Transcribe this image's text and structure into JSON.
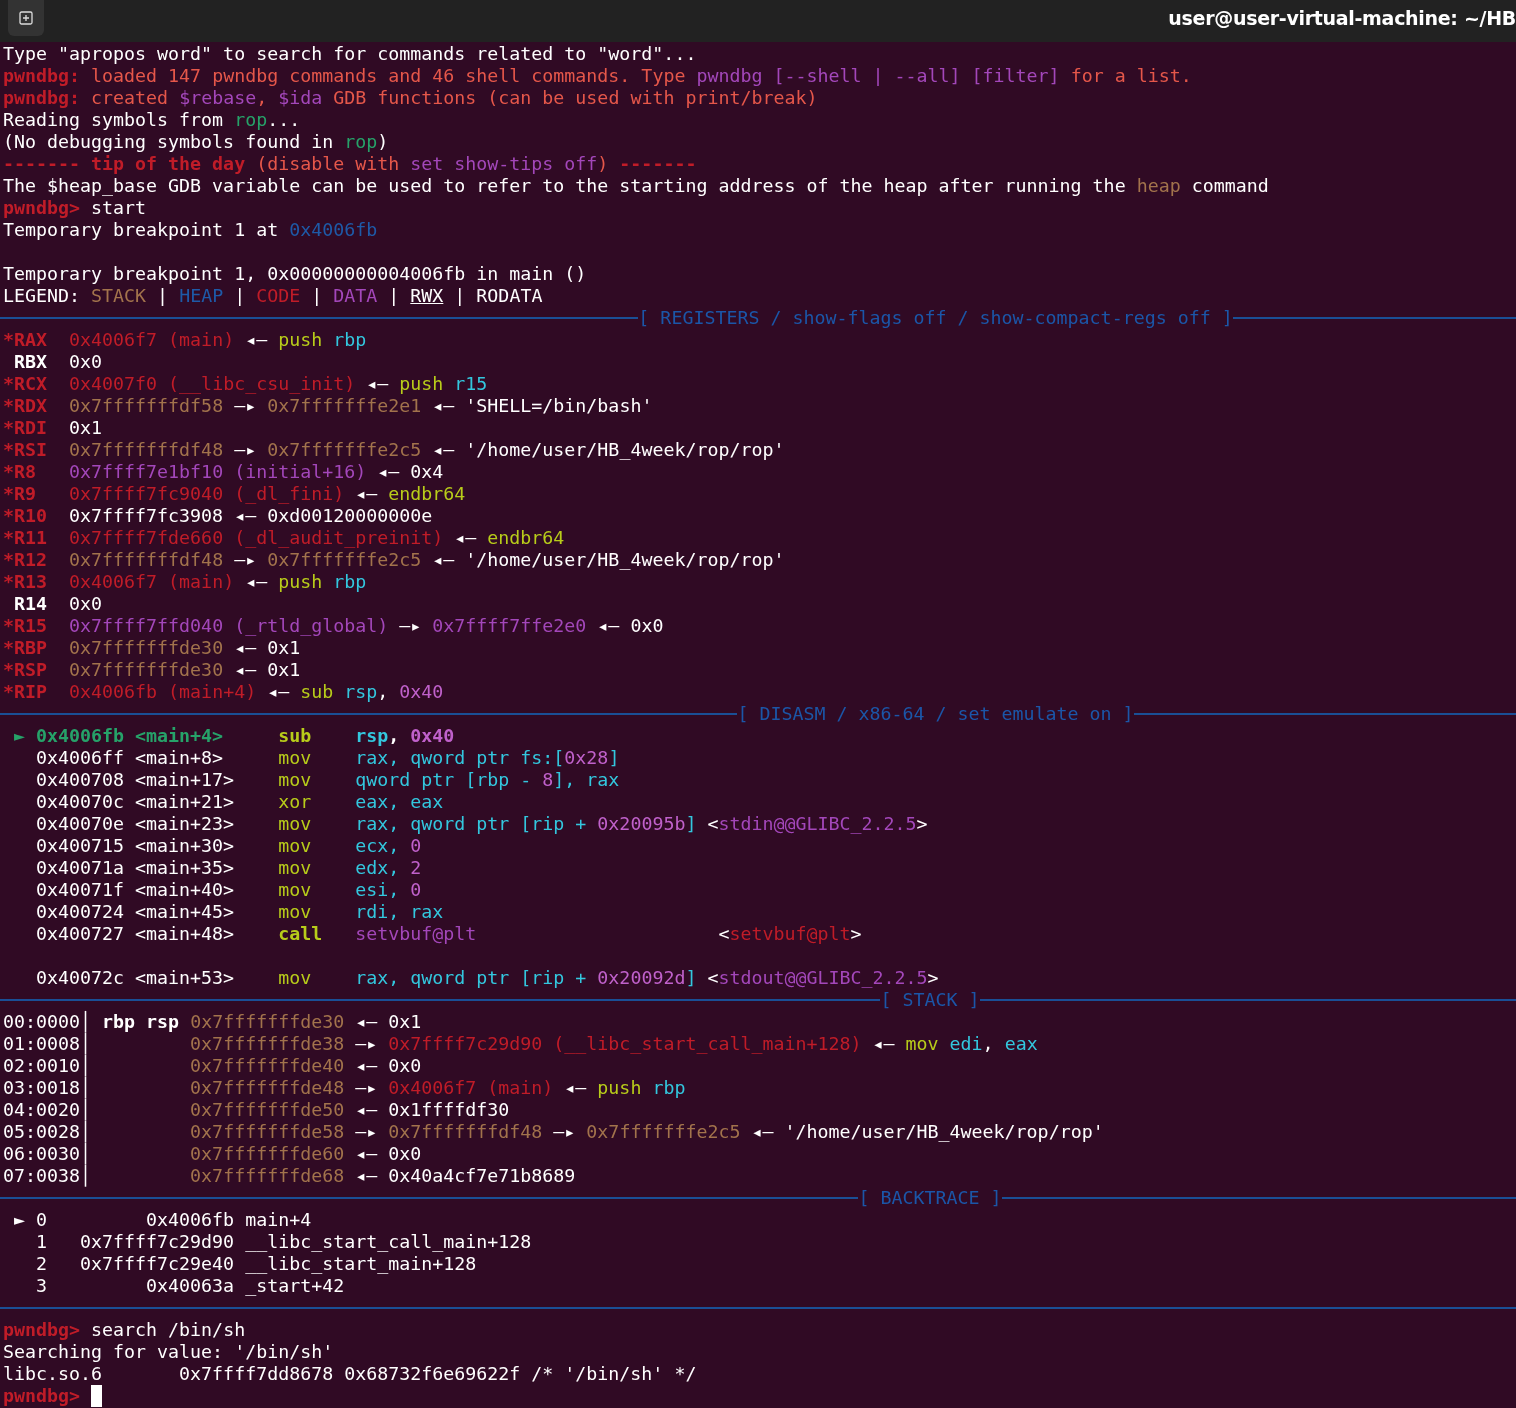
{
  "window": {
    "title": "user@user-virtual-machine: ~/HB"
  },
  "lines": [
    {
      "kind": "text",
      "segs": [
        {
          "text": "Type \"apropos word\" to search for commands related to \"word\"...",
          "kind": "plain"
        }
      ]
    },
    {
      "kind": "text",
      "segs": [
        {
          "text": "pwndbg: ",
          "kind": "prompt"
        },
        {
          "text": "loaded 147 pwndbg commands and 46 shell commands. Type ",
          "kind": "notice"
        },
        {
          "text": "pwndbg [--shell | --all] [filter]",
          "kind": "data"
        },
        {
          "text": " for a list.",
          "kind": "notice"
        }
      ]
    },
    {
      "kind": "text",
      "segs": [
        {
          "text": "pwndbg: ",
          "kind": "prompt"
        },
        {
          "text": "created ",
          "kind": "notice"
        },
        {
          "text": "$rebase",
          "kind": "data"
        },
        {
          "text": ", ",
          "kind": "notice"
        },
        {
          "text": "$ida",
          "kind": "data"
        },
        {
          "text": " GDB functions (can be used with print/break)",
          "kind": "notice"
        }
      ]
    },
    {
      "kind": "text",
      "segs": [
        {
          "text": "Reading symbols from ",
          "kind": "plain"
        },
        {
          "text": "rop",
          "kind": "file"
        },
        {
          "text": "...",
          "kind": "plain"
        }
      ]
    },
    {
      "kind": "text",
      "segs": [
        {
          "text": "(No debugging symbols found in ",
          "kind": "plain"
        },
        {
          "text": "rop",
          "kind": "file"
        },
        {
          "text": ")",
          "kind": "plain"
        }
      ]
    },
    {
      "kind": "text",
      "segs": [
        {
          "text": "------- tip of the day",
          "kind": "prompt"
        },
        {
          "text": " (disable with ",
          "kind": "notice"
        },
        {
          "text": "set show-tips off",
          "kind": "data"
        },
        {
          "text": ") ",
          "kind": "notice"
        },
        {
          "text": "-------",
          "kind": "prompt"
        }
      ]
    },
    {
      "kind": "text",
      "segs": [
        {
          "text": "The $heap_base GDB variable can be used to refer to the starting address of the heap after running the ",
          "kind": "plain"
        },
        {
          "text": "heap",
          "kind": "stack"
        },
        {
          "text": " command",
          "kind": "plain"
        }
      ]
    },
    {
      "kind": "text",
      "segs": [
        {
          "text": "pwndbg>",
          "kind": "prompt"
        },
        {
          "text": " start",
          "kind": "plain"
        }
      ]
    },
    {
      "kind": "text",
      "segs": [
        {
          "text": "Temporary breakpoint 1 at ",
          "kind": "plain"
        },
        {
          "text": "0x4006fb",
          "kind": "heap"
        }
      ]
    },
    {
      "kind": "blank"
    },
    {
      "kind": "text",
      "segs": [
        {
          "text": "Temporary breakpoint 1, 0x00000000004006fb in main ()",
          "kind": "plain"
        }
      ]
    },
    {
      "kind": "text",
      "segs": [
        {
          "text": "LEGEND: ",
          "kind": "plain"
        },
        {
          "text": "STACK",
          "kind": "stack"
        },
        {
          "text": " | ",
          "kind": "plain"
        },
        {
          "text": "HEAP",
          "kind": "heap"
        },
        {
          "text": " | ",
          "kind": "plain"
        },
        {
          "text": "CODE",
          "kind": "code"
        },
        {
          "text": " | ",
          "kind": "plain"
        },
        {
          "text": "DATA",
          "kind": "data"
        },
        {
          "text": " | ",
          "kind": "plain"
        },
        {
          "text": "RWX",
          "kind": "rwx"
        },
        {
          "text": " | RODATA",
          "kind": "plain"
        }
      ]
    },
    {
      "kind": "rule",
      "label": "[ REGISTERS / show-flags off / show-compact-regs off ]"
    },
    {
      "kind": "text",
      "segs": [
        {
          "text": "*RAX  ",
          "kind": "regmod"
        },
        {
          "text": "0x4006f7 (main)",
          "kind": "code"
        },
        {
          "text": " ◂— ",
          "kind": "plain"
        },
        {
          "text": "push",
          "kind": "op"
        },
        {
          "text": " rbp",
          "kind": "operand"
        }
      ]
    },
    {
      "kind": "text",
      "segs": [
        {
          "text": " RBX",
          "kind": "reg"
        },
        {
          "text": "  0x0",
          "kind": "plain"
        }
      ]
    },
    {
      "kind": "text",
      "segs": [
        {
          "text": "*RCX  ",
          "kind": "regmod"
        },
        {
          "text": "0x4007f0 (__libc_csu_init)",
          "kind": "code"
        },
        {
          "text": " ◂— ",
          "kind": "plain"
        },
        {
          "text": "push",
          "kind": "op"
        },
        {
          "text": " r15",
          "kind": "operand"
        }
      ]
    },
    {
      "kind": "text",
      "segs": [
        {
          "text": "*RDX  ",
          "kind": "regmod"
        },
        {
          "text": "0x7fffffffdf58",
          "kind": "stack"
        },
        {
          "text": " —▸ ",
          "kind": "plain"
        },
        {
          "text": "0x7fffffffe2e1",
          "kind": "stack"
        },
        {
          "text": " ◂— 'SHELL=/bin/bash'",
          "kind": "plain"
        }
      ]
    },
    {
      "kind": "text",
      "segs": [
        {
          "text": "*RDI",
          "kind": "regmod"
        },
        {
          "text": "  0x1",
          "kind": "plain"
        }
      ]
    },
    {
      "kind": "text",
      "segs": [
        {
          "text": "*RSI  ",
          "kind": "regmod"
        },
        {
          "text": "0x7fffffffdf48",
          "kind": "stack"
        },
        {
          "text": " —▸ ",
          "kind": "plain"
        },
        {
          "text": "0x7fffffffe2c5",
          "kind": "stack"
        },
        {
          "text": " ◂— '/home/user/HB_4week/rop/rop'",
          "kind": "plain"
        }
      ]
    },
    {
      "kind": "text",
      "segs": [
        {
          "text": "*R8   ",
          "kind": "regmod"
        },
        {
          "text": "0x7ffff7e1bf10 (initial+16)",
          "kind": "data"
        },
        {
          "text": " ◂— 0x4",
          "kind": "plain"
        }
      ]
    },
    {
      "kind": "text",
      "segs": [
        {
          "text": "*R9   ",
          "kind": "regmod"
        },
        {
          "text": "0x7ffff7fc9040 (_dl_fini)",
          "kind": "code"
        },
        {
          "text": " ◂— ",
          "kind": "plain"
        },
        {
          "text": "endbr64",
          "kind": "op"
        }
      ]
    },
    {
      "kind": "text",
      "segs": [
        {
          "text": "*R10",
          "kind": "regmod"
        },
        {
          "text": "  0x7ffff7fc3908 ◂— 0xd00120000000e",
          "kind": "plain"
        }
      ]
    },
    {
      "kind": "text",
      "segs": [
        {
          "text": "*R11  ",
          "kind": "regmod"
        },
        {
          "text": "0x7ffff7fde660 (_dl_audit_preinit)",
          "kind": "code"
        },
        {
          "text": " ◂— ",
          "kind": "plain"
        },
        {
          "text": "endbr64",
          "kind": "op"
        }
      ]
    },
    {
      "kind": "text",
      "segs": [
        {
          "text": "*R12  ",
          "kind": "regmod"
        },
        {
          "text": "0x7fffffffdf48",
          "kind": "stack"
        },
        {
          "text": " —▸ ",
          "kind": "plain"
        },
        {
          "text": "0x7fffffffe2c5",
          "kind": "stack"
        },
        {
          "text": " ◂— '/home/user/HB_4week/rop/rop'",
          "kind": "plain"
        }
      ]
    },
    {
      "kind": "text",
      "segs": [
        {
          "text": "*R13  ",
          "kind": "regmod"
        },
        {
          "text": "0x4006f7 (main)",
          "kind": "code"
        },
        {
          "text": " ◂— ",
          "kind": "plain"
        },
        {
          "text": "push",
          "kind": "op"
        },
        {
          "text": " rbp",
          "kind": "operand"
        }
      ]
    },
    {
      "kind": "text",
      "segs": [
        {
          "text": " R14",
          "kind": "reg"
        },
        {
          "text": "  0x0",
          "kind": "plain"
        }
      ]
    },
    {
      "kind": "text",
      "segs": [
        {
          "text": "*R15  ",
          "kind": "regmod"
        },
        {
          "text": "0x7ffff7ffd040 (_rtld_global)",
          "kind": "data"
        },
        {
          "text": " —▸ ",
          "kind": "plain"
        },
        {
          "text": "0x7ffff7ffe2e0",
          "kind": "data"
        },
        {
          "text": " ◂— 0x0",
          "kind": "plain"
        }
      ]
    },
    {
      "kind": "text",
      "segs": [
        {
          "text": "*RBP  ",
          "kind": "regmod"
        },
        {
          "text": "0x7fffffffde30",
          "kind": "stack"
        },
        {
          "text": " ◂— 0x1",
          "kind": "plain"
        }
      ]
    },
    {
      "kind": "text",
      "segs": [
        {
          "text": "*RSP  ",
          "kind": "regmod"
        },
        {
          "text": "0x7fffffffde30",
          "kind": "stack"
        },
        {
          "text": " ◂— 0x1",
          "kind": "plain"
        }
      ]
    },
    {
      "kind": "text",
      "segs": [
        {
          "text": "*RIP  ",
          "kind": "regmod"
        },
        {
          "text": "0x4006fb (main+4)",
          "kind": "code"
        },
        {
          "text": " ◂— ",
          "kind": "plain"
        },
        {
          "text": "sub",
          "kind": "op"
        },
        {
          "text": " rsp",
          "kind": "operand"
        },
        {
          "text": ", ",
          "kind": "plain"
        },
        {
          "text": "0x40",
          "kind": "num"
        }
      ]
    },
    {
      "kind": "rule",
      "label": "[ DISASM / x86-64 / set emulate on ]"
    },
    {
      "kind": "text",
      "segs": [
        {
          "text": " ► 0x4006fb <main+4>     ",
          "kind": "current"
        },
        {
          "text": "sub    ",
          "kind": "opbold"
        },
        {
          "text": "rsp",
          "kind": "operandbold"
        },
        {
          "text": ", ",
          "kind": "plainbold"
        },
        {
          "text": "0x40",
          "kind": "numbold"
        }
      ]
    },
    {
      "kind": "text",
      "segs": [
        {
          "text": "   0x4006ff <main+8>     ",
          "kind": "plain"
        },
        {
          "text": "mov",
          "kind": "op"
        },
        {
          "text": "    rax, qword ptr fs:[",
          "kind": "operand"
        },
        {
          "text": "0x28",
          "kind": "num"
        },
        {
          "text": "]",
          "kind": "operand"
        }
      ]
    },
    {
      "kind": "text",
      "segs": [
        {
          "text": "   0x400708 <main+17>    ",
          "kind": "plain"
        },
        {
          "text": "mov",
          "kind": "op"
        },
        {
          "text": "    qword ptr [rbp - ",
          "kind": "operand"
        },
        {
          "text": "8",
          "kind": "num"
        },
        {
          "text": "], rax",
          "kind": "operand"
        }
      ]
    },
    {
      "kind": "text",
      "segs": [
        {
          "text": "   0x40070c <main+21>    ",
          "kind": "plain"
        },
        {
          "text": "xor",
          "kind": "op"
        },
        {
          "text": "    eax, eax",
          "kind": "operand"
        }
      ]
    },
    {
      "kind": "text",
      "segs": [
        {
          "text": "   0x40070e <main+23>    ",
          "kind": "plain"
        },
        {
          "text": "mov",
          "kind": "op"
        },
        {
          "text": "    rax, qword ptr [rip + ",
          "kind": "operand"
        },
        {
          "text": "0x20095b",
          "kind": "num"
        },
        {
          "text": "]",
          "kind": "operand"
        },
        {
          "text": " <",
          "kind": "plain"
        },
        {
          "text": "stdin@@GLIBC_2.2.5",
          "kind": "data"
        },
        {
          "text": ">",
          "kind": "plain"
        }
      ]
    },
    {
      "kind": "text",
      "segs": [
        {
          "text": "   0x400715 <main+30>    ",
          "kind": "plain"
        },
        {
          "text": "mov",
          "kind": "op"
        },
        {
          "text": "    ecx, ",
          "kind": "operand"
        },
        {
          "text": "0",
          "kind": "num"
        }
      ]
    },
    {
      "kind": "text",
      "segs": [
        {
          "text": "   0x40071a <main+35>    ",
          "kind": "plain"
        },
        {
          "text": "mov",
          "kind": "op"
        },
        {
          "text": "    edx, ",
          "kind": "operand"
        },
        {
          "text": "2",
          "kind": "num"
        }
      ]
    },
    {
      "kind": "text",
      "segs": [
        {
          "text": "   0x40071f <main+40>    ",
          "kind": "plain"
        },
        {
          "text": "mov",
          "kind": "op"
        },
        {
          "text": "    esi, ",
          "kind": "operand"
        },
        {
          "text": "0",
          "kind": "num"
        }
      ]
    },
    {
      "kind": "text",
      "segs": [
        {
          "text": "   0x400724 <main+45>    ",
          "kind": "plain"
        },
        {
          "text": "mov",
          "kind": "op"
        },
        {
          "text": "    rdi, rax",
          "kind": "operand"
        }
      ]
    },
    {
      "kind": "text",
      "segs": [
        {
          "text": "   0x400727 <main+48>    ",
          "kind": "plain"
        },
        {
          "text": "call   ",
          "kind": "opbold"
        },
        {
          "text": "setvbuf@plt",
          "kind": "data"
        },
        {
          "text": "                      <",
          "kind": "plain"
        },
        {
          "text": "setvbuf@plt",
          "kind": "code"
        },
        {
          "text": ">",
          "kind": "plain"
        }
      ]
    },
    {
      "kind": "blank"
    },
    {
      "kind": "text",
      "segs": [
        {
          "text": "   0x40072c <main+53>    ",
          "kind": "plain"
        },
        {
          "text": "mov",
          "kind": "op"
        },
        {
          "text": "    rax, qword ptr [rip + ",
          "kind": "operand"
        },
        {
          "text": "0x20092d",
          "kind": "num"
        },
        {
          "text": "]",
          "kind": "operand"
        },
        {
          "text": " <",
          "kind": "plain"
        },
        {
          "text": "stdout@@GLIBC_2.2.5",
          "kind": "data"
        },
        {
          "text": ">",
          "kind": "plain"
        }
      ]
    },
    {
      "kind": "rule",
      "label": "[ STACK ]"
    },
    {
      "kind": "text",
      "segs": [
        {
          "text": "00:0000│ ",
          "kind": "plain"
        },
        {
          "text": "rbp rsp ",
          "kind": "plainbold"
        },
        {
          "text": "0x7fffffffde30",
          "kind": "stack"
        },
        {
          "text": " ◂— 0x1",
          "kind": "plain"
        }
      ]
    },
    {
      "kind": "text",
      "segs": [
        {
          "text": "01:0008│         ",
          "kind": "plain"
        },
        {
          "text": "0x7fffffffde38",
          "kind": "stack"
        },
        {
          "text": " —▸ ",
          "kind": "plain"
        },
        {
          "text": "0x7ffff7c29d90 (__libc_start_call_main+128)",
          "kind": "code"
        },
        {
          "text": " ◂— ",
          "kind": "plain"
        },
        {
          "text": "mov",
          "kind": "op"
        },
        {
          "text": " edi",
          "kind": "operand"
        },
        {
          "text": ", ",
          "kind": "plain"
        },
        {
          "text": "eax",
          "kind": "operand"
        }
      ]
    },
    {
      "kind": "text",
      "segs": [
        {
          "text": "02:0010│         ",
          "kind": "plain"
        },
        {
          "text": "0x7fffffffde40",
          "kind": "stack"
        },
        {
          "text": " ◂— 0x0",
          "kind": "plain"
        }
      ]
    },
    {
      "kind": "text",
      "segs": [
        {
          "text": "03:0018│         ",
          "kind": "plain"
        },
        {
          "text": "0x7fffffffde48",
          "kind": "stack"
        },
        {
          "text": " —▸ ",
          "kind": "plain"
        },
        {
          "text": "0x4006f7 (main)",
          "kind": "code"
        },
        {
          "text": " ◂— ",
          "kind": "plain"
        },
        {
          "text": "push",
          "kind": "op"
        },
        {
          "text": " rbp",
          "kind": "operand"
        }
      ]
    },
    {
      "kind": "text",
      "segs": [
        {
          "text": "04:0020│         ",
          "kind": "plain"
        },
        {
          "text": "0x7fffffffde50",
          "kind": "stack"
        },
        {
          "text": " ◂— 0x1ffffdf30",
          "kind": "plain"
        }
      ]
    },
    {
      "kind": "text",
      "segs": [
        {
          "text": "05:0028│         ",
          "kind": "plain"
        },
        {
          "text": "0x7fffffffde58",
          "kind": "stack"
        },
        {
          "text": " —▸ ",
          "kind": "plain"
        },
        {
          "text": "0x7fffffffdf48",
          "kind": "stack"
        },
        {
          "text": " —▸ ",
          "kind": "plain"
        },
        {
          "text": "0x7fffffffe2c5",
          "kind": "stack"
        },
        {
          "text": " ◂— '/home/user/HB_4week/rop/rop'",
          "kind": "plain"
        }
      ]
    },
    {
      "kind": "text",
      "segs": [
        {
          "text": "06:0030│         ",
          "kind": "plain"
        },
        {
          "text": "0x7fffffffde60",
          "kind": "stack"
        },
        {
          "text": " ◂— 0x0",
          "kind": "plain"
        }
      ]
    },
    {
      "kind": "text",
      "segs": [
        {
          "text": "07:0038│         ",
          "kind": "plain"
        },
        {
          "text": "0x7fffffffde68",
          "kind": "stack"
        },
        {
          "text": " ◂— 0x40a4cf7e71b8689",
          "kind": "plain"
        }
      ]
    },
    {
      "kind": "rule",
      "label": "[ BACKTRACE ]"
    },
    {
      "kind": "text",
      "segs": [
        {
          "text": " ► 0         0x4006fb main+4",
          "kind": "plain"
        }
      ]
    },
    {
      "kind": "text",
      "segs": [
        {
          "text": "   1   0x7ffff7c29d90 __libc_start_call_main+128",
          "kind": "plain"
        }
      ]
    },
    {
      "kind": "text",
      "segs": [
        {
          "text": "   2   0x7ffff7c29e40 __libc_start_main+128",
          "kind": "plain"
        }
      ]
    },
    {
      "kind": "text",
      "segs": [
        {
          "text": "   3         0x40063a _start+42",
          "kind": "plain"
        }
      ]
    },
    {
      "kind": "rule"
    },
    {
      "kind": "text",
      "segs": [
        {
          "text": "pwndbg>",
          "kind": "prompt"
        },
        {
          "text": " search /bin/sh",
          "kind": "plain"
        }
      ]
    },
    {
      "kind": "text",
      "segs": [
        {
          "text": "Searching for value: '/bin/sh'",
          "kind": "plain"
        }
      ]
    },
    {
      "kind": "text",
      "segs": [
        {
          "text": "libc.so.6       0x7ffff7dd8678 0x68732f6e69622f /* '/bin/sh' */",
          "kind": "plain"
        }
      ]
    },
    {
      "kind": "text",
      "cursor": true,
      "segs": [
        {
          "text": "pwndbg> ",
          "kind": "prompt"
        }
      ]
    }
  ]
}
